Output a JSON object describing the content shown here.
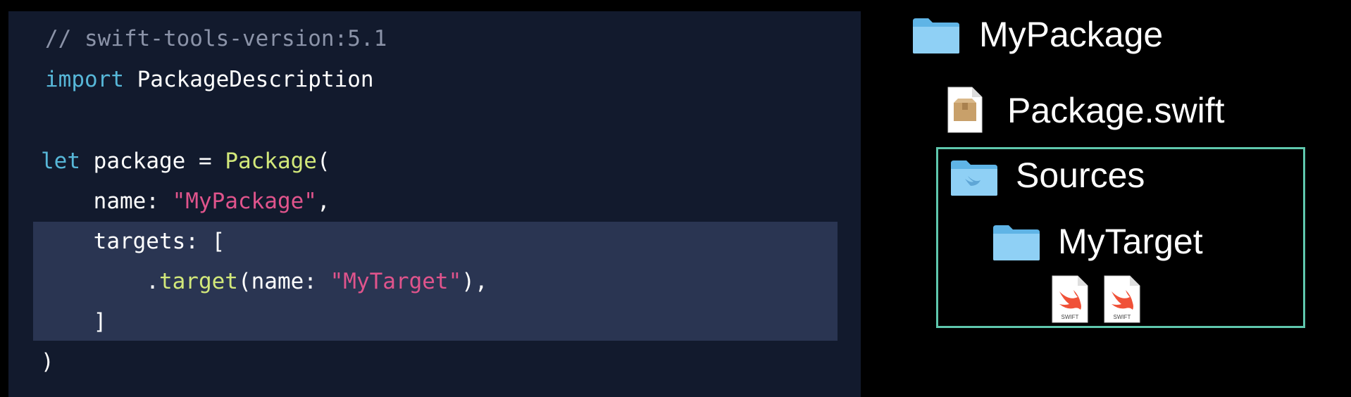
{
  "code": {
    "lines": [
      {
        "tokens": [
          {
            "cls": "tok-comment",
            "text": "// swift-tools-version:5.1"
          }
        ]
      },
      {
        "tokens": [
          {
            "cls": "tok-keyword",
            "text": "import"
          },
          {
            "cls": "tok-plain",
            "text": " PackageDescription"
          }
        ]
      },
      {
        "tokens": []
      },
      {
        "tokens": [
          {
            "cls": "tok-keyword",
            "text": "let"
          },
          {
            "cls": "tok-plain",
            "text": " package = "
          },
          {
            "cls": "tok-type",
            "text": "Package"
          },
          {
            "cls": "tok-plain",
            "text": "("
          }
        ]
      },
      {
        "tokens": [
          {
            "cls": "tok-plain",
            "text": "    name: "
          },
          {
            "cls": "tok-string",
            "text": "\"MyPackage\""
          },
          {
            "cls": "tok-plain",
            "text": ","
          }
        ]
      },
      {
        "tokens": [
          {
            "cls": "tok-plain",
            "text": "    targets: ["
          }
        ]
      },
      {
        "tokens": [
          {
            "cls": "tok-plain",
            "text": "        ."
          },
          {
            "cls": "tok-method",
            "text": "target"
          },
          {
            "cls": "tok-plain",
            "text": "(name: "
          },
          {
            "cls": "tok-string",
            "text": "\"MyTarget\""
          },
          {
            "cls": "tok-plain",
            "text": "),"
          }
        ]
      },
      {
        "tokens": [
          {
            "cls": "tok-plain",
            "text": "    ]"
          }
        ]
      },
      {
        "tokens": [
          {
            "cls": "tok-plain",
            "text": ")"
          }
        ]
      }
    ]
  },
  "tree": {
    "root_label": "MyPackage",
    "manifest_label": "Package.swift",
    "sources_label": "Sources",
    "target_label": "MyTarget",
    "swift_file_badge": "SWIFT"
  },
  "colors": {
    "background": "#000000",
    "code_background": "#121a2d",
    "highlight": "#2a3552",
    "sources_border": "#5fc7ad",
    "folder": "#7cc6f0"
  },
  "icons": {
    "root": "folder-icon",
    "manifest": "package-file-icon",
    "sources": "swift-sources-folder-icon",
    "target": "folder-icon",
    "files": [
      "swift-file-icon",
      "swift-file-icon"
    ]
  }
}
